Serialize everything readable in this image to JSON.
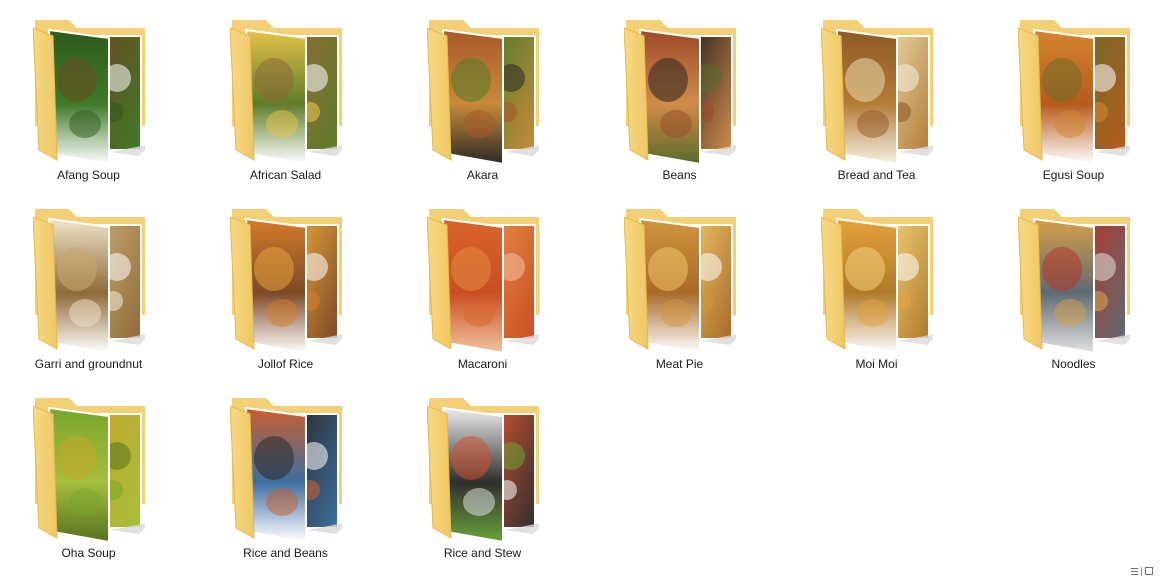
{
  "window": {
    "view": "Large icons"
  },
  "folders": [
    {
      "label": "Afang Soup",
      "icon": "folder-food-icon",
      "photo_colors": [
        "#2f5a1d",
        "#6b4a22",
        "#ffffff",
        "#3f7a28"
      ]
    },
    {
      "label": "African Salad",
      "icon": "folder-food-icon",
      "photo_colors": [
        "#e7c34a",
        "#8e6a38",
        "#ffffff",
        "#5e7c2a"
      ]
    },
    {
      "label": "Akara",
      "icon": "folder-food-icon",
      "photo_colors": [
        "#a9592a",
        "#4e7d28",
        "#2b2a26",
        "#c88a3b"
      ]
    },
    {
      "label": "Beans",
      "icon": "folder-food-icon",
      "photo_colors": [
        "#9c4a28",
        "#2a2320",
        "#5a6a2a",
        "#d18b4a"
      ]
    },
    {
      "label": "Bread and Tea",
      "icon": "folder-food-icon",
      "photo_colors": [
        "#8f5a26",
        "#e9d9ad",
        "#f5f1e3",
        "#b57c37"
      ]
    },
    {
      "label": "Egusi Soup",
      "icon": "folder-food-icon",
      "photo_colors": [
        "#d2862f",
        "#6e6e2a",
        "#ffffff",
        "#b65a1c"
      ]
    },
    {
      "label": "Garri and groundnut",
      "icon": "folder-food-icon",
      "photo_colors": [
        "#eee3c9",
        "#c8a76f",
        "#ffffff",
        "#8f6a3a"
      ]
    },
    {
      "label": "Jollof Rice",
      "icon": "folder-food-icon",
      "photo_colors": [
        "#d57b2b",
        "#e8a33b",
        "#ffffff",
        "#7c4a26"
      ]
    },
    {
      "label": "Macaroni",
      "icon": "folder-food-icon",
      "photo_colors": [
        "#d9652d",
        "#e58b46",
        "#f2c3a0",
        "#c94e22"
      ]
    },
    {
      "label": "Meat Pie",
      "icon": "folder-food-icon",
      "photo_colors": [
        "#d1953e",
        "#f0c56a",
        "#ffffff",
        "#a86a28"
      ]
    },
    {
      "label": "Moi Moi",
      "icon": "folder-food-icon",
      "photo_colors": [
        "#e6a13a",
        "#f4d27d",
        "#ffffff",
        "#b07a2b"
      ]
    },
    {
      "label": "Noodles",
      "icon": "folder-food-icon",
      "photo_colors": [
        "#d6a04a",
        "#b4362a",
        "#e2e2e2",
        "#5f6a72"
      ]
    },
    {
      "label": "Oha Soup",
      "icon": "folder-food-icon",
      "photo_colors": [
        "#7aa62a",
        "#c6a72c",
        "#55721f",
        "#a6be3e"
      ]
    },
    {
      "label": "Rice and Beans",
      "icon": "folder-food-icon",
      "photo_colors": [
        "#c95e2e",
        "#2a2a2a",
        "#ffffff",
        "#3e6ea0"
      ]
    },
    {
      "label": "Rice and Stew",
      "icon": "folder-food-icon",
      "photo_colors": [
        "#ececec",
        "#d1512e",
        "#6aa43a",
        "#2f2f2f"
      ]
    }
  ],
  "statusbar": {
    "details_view_icon": "details-view-icon",
    "large_icons_view_icon": "large-icons-view-icon"
  }
}
